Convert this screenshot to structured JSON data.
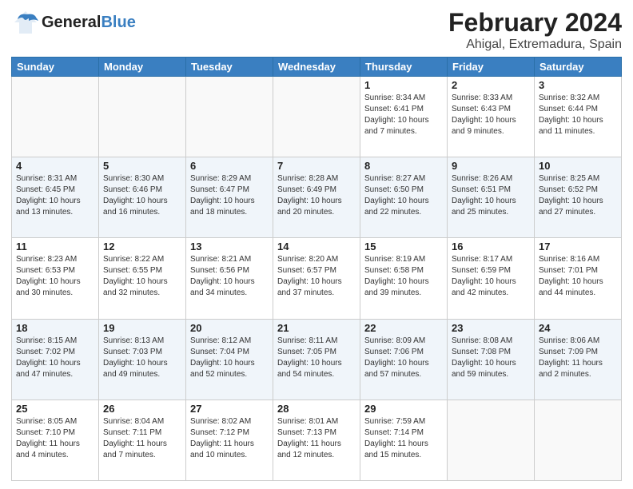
{
  "header": {
    "logo_general": "General",
    "logo_blue": "Blue",
    "title": "February 2024",
    "subtitle": "Ahigal, Extremadura, Spain"
  },
  "days_of_week": [
    "Sunday",
    "Monday",
    "Tuesday",
    "Wednesday",
    "Thursday",
    "Friday",
    "Saturday"
  ],
  "weeks": [
    [
      {
        "day": "",
        "detail": ""
      },
      {
        "day": "",
        "detail": ""
      },
      {
        "day": "",
        "detail": ""
      },
      {
        "day": "",
        "detail": ""
      },
      {
        "day": "1",
        "detail": "Sunrise: 8:34 AM\nSunset: 6:41 PM\nDaylight: 10 hours\nand 7 minutes."
      },
      {
        "day": "2",
        "detail": "Sunrise: 8:33 AM\nSunset: 6:43 PM\nDaylight: 10 hours\nand 9 minutes."
      },
      {
        "day": "3",
        "detail": "Sunrise: 8:32 AM\nSunset: 6:44 PM\nDaylight: 10 hours\nand 11 minutes."
      }
    ],
    [
      {
        "day": "4",
        "detail": "Sunrise: 8:31 AM\nSunset: 6:45 PM\nDaylight: 10 hours\nand 13 minutes."
      },
      {
        "day": "5",
        "detail": "Sunrise: 8:30 AM\nSunset: 6:46 PM\nDaylight: 10 hours\nand 16 minutes."
      },
      {
        "day": "6",
        "detail": "Sunrise: 8:29 AM\nSunset: 6:47 PM\nDaylight: 10 hours\nand 18 minutes."
      },
      {
        "day": "7",
        "detail": "Sunrise: 8:28 AM\nSunset: 6:49 PM\nDaylight: 10 hours\nand 20 minutes."
      },
      {
        "day": "8",
        "detail": "Sunrise: 8:27 AM\nSunset: 6:50 PM\nDaylight: 10 hours\nand 22 minutes."
      },
      {
        "day": "9",
        "detail": "Sunrise: 8:26 AM\nSunset: 6:51 PM\nDaylight: 10 hours\nand 25 minutes."
      },
      {
        "day": "10",
        "detail": "Sunrise: 8:25 AM\nSunset: 6:52 PM\nDaylight: 10 hours\nand 27 minutes."
      }
    ],
    [
      {
        "day": "11",
        "detail": "Sunrise: 8:23 AM\nSunset: 6:53 PM\nDaylight: 10 hours\nand 30 minutes."
      },
      {
        "day": "12",
        "detail": "Sunrise: 8:22 AM\nSunset: 6:55 PM\nDaylight: 10 hours\nand 32 minutes."
      },
      {
        "day": "13",
        "detail": "Sunrise: 8:21 AM\nSunset: 6:56 PM\nDaylight: 10 hours\nand 34 minutes."
      },
      {
        "day": "14",
        "detail": "Sunrise: 8:20 AM\nSunset: 6:57 PM\nDaylight: 10 hours\nand 37 minutes."
      },
      {
        "day": "15",
        "detail": "Sunrise: 8:19 AM\nSunset: 6:58 PM\nDaylight: 10 hours\nand 39 minutes."
      },
      {
        "day": "16",
        "detail": "Sunrise: 8:17 AM\nSunset: 6:59 PM\nDaylight: 10 hours\nand 42 minutes."
      },
      {
        "day": "17",
        "detail": "Sunrise: 8:16 AM\nSunset: 7:01 PM\nDaylight: 10 hours\nand 44 minutes."
      }
    ],
    [
      {
        "day": "18",
        "detail": "Sunrise: 8:15 AM\nSunset: 7:02 PM\nDaylight: 10 hours\nand 47 minutes."
      },
      {
        "day": "19",
        "detail": "Sunrise: 8:13 AM\nSunset: 7:03 PM\nDaylight: 10 hours\nand 49 minutes."
      },
      {
        "day": "20",
        "detail": "Sunrise: 8:12 AM\nSunset: 7:04 PM\nDaylight: 10 hours\nand 52 minutes."
      },
      {
        "day": "21",
        "detail": "Sunrise: 8:11 AM\nSunset: 7:05 PM\nDaylight: 10 hours\nand 54 minutes."
      },
      {
        "day": "22",
        "detail": "Sunrise: 8:09 AM\nSunset: 7:06 PM\nDaylight: 10 hours\nand 57 minutes."
      },
      {
        "day": "23",
        "detail": "Sunrise: 8:08 AM\nSunset: 7:08 PM\nDaylight: 10 hours\nand 59 minutes."
      },
      {
        "day": "24",
        "detail": "Sunrise: 8:06 AM\nSunset: 7:09 PM\nDaylight: 11 hours\nand 2 minutes."
      }
    ],
    [
      {
        "day": "25",
        "detail": "Sunrise: 8:05 AM\nSunset: 7:10 PM\nDaylight: 11 hours\nand 4 minutes."
      },
      {
        "day": "26",
        "detail": "Sunrise: 8:04 AM\nSunset: 7:11 PM\nDaylight: 11 hours\nand 7 minutes."
      },
      {
        "day": "27",
        "detail": "Sunrise: 8:02 AM\nSunset: 7:12 PM\nDaylight: 11 hours\nand 10 minutes."
      },
      {
        "day": "28",
        "detail": "Sunrise: 8:01 AM\nSunset: 7:13 PM\nDaylight: 11 hours\nand 12 minutes."
      },
      {
        "day": "29",
        "detail": "Sunrise: 7:59 AM\nSunset: 7:14 PM\nDaylight: 11 hours\nand 15 minutes."
      },
      {
        "day": "",
        "detail": ""
      },
      {
        "day": "",
        "detail": ""
      }
    ]
  ]
}
